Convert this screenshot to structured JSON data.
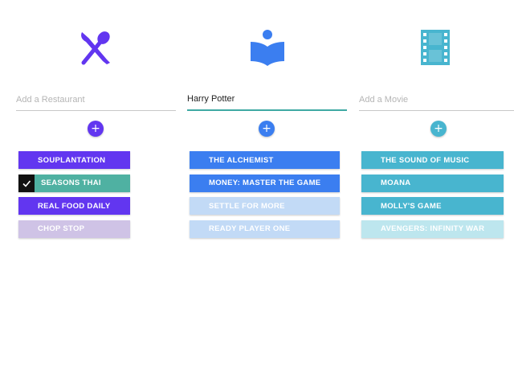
{
  "columns": [
    {
      "id": "restaurants",
      "icon": "restaurant-icon",
      "color": "#6236f0",
      "input": {
        "value": "",
        "placeholder": "Add a Restaurant"
      },
      "add_label": "+",
      "items": [
        {
          "label": "SOUPLANTATION",
          "state": "normal",
          "color": "#6236f0"
        },
        {
          "label": "SEASONS THAI",
          "state": "checked",
          "color": "#4fb1a2"
        },
        {
          "label": "REAL FOOD DAILY",
          "state": "normal",
          "color": "#6236f0"
        },
        {
          "label": "CHOP STOP",
          "state": "faded",
          "color": "#cfc3e6"
        }
      ]
    },
    {
      "id": "books",
      "icon": "book-reader-icon",
      "color": "#3b7ef0",
      "input": {
        "value": "Harry Potter",
        "placeholder": ""
      },
      "add_label": "+",
      "items": [
        {
          "label": "THE ALCHEMIST",
          "state": "normal",
          "color": "#3b7ef0"
        },
        {
          "label": "MONEY: MASTER THE GAME",
          "state": "normal",
          "color": "#3b7ef0"
        },
        {
          "label": "SETTLE FOR MORE",
          "state": "faded",
          "color": "#c2daf6"
        },
        {
          "label": "READY PLAYER ONE",
          "state": "faded",
          "color": "#c2daf6"
        }
      ]
    },
    {
      "id": "movies",
      "icon": "film-strip-icon",
      "color": "#48b5cf",
      "input": {
        "value": "",
        "placeholder": "Add a Movie"
      },
      "add_label": "+",
      "items": [
        {
          "label": "THE SOUND OF MUSIC",
          "state": "normal",
          "color": "#48b5cf"
        },
        {
          "label": "MOANA",
          "state": "normal",
          "color": "#48b5cf"
        },
        {
          "label": "MOLLY'S GAME",
          "state": "normal",
          "color": "#48b5cf"
        },
        {
          "label": "AVENGERS: INFINITY WAR",
          "state": "faded",
          "color": "#bde6ee"
        }
      ]
    }
  ]
}
